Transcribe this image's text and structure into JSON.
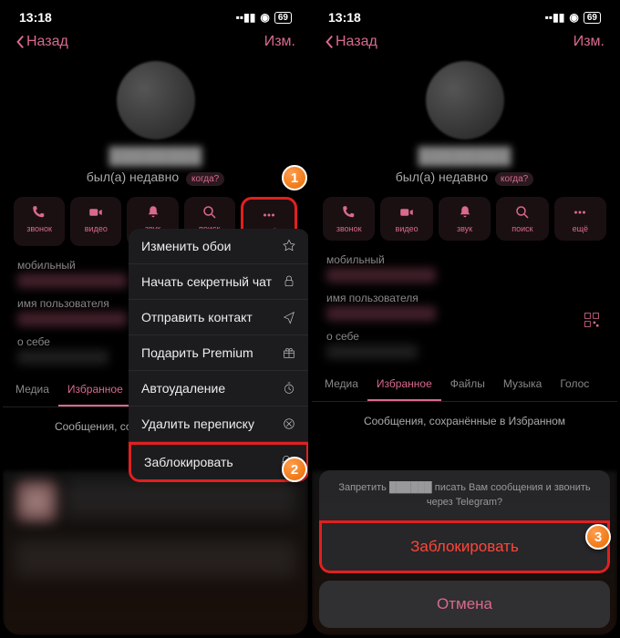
{
  "sb": {
    "time": "13:18",
    "bat": "69"
  },
  "nav": {
    "back": "Назад",
    "edit": "Изм."
  },
  "profile": {
    "name": "████████",
    "status": "был(а) недавно",
    "when": "когда?"
  },
  "act": {
    "call": "звонок",
    "video": "видео",
    "mute": "звук",
    "search": "поиск",
    "more": "ещё"
  },
  "info": {
    "mobile": "мобильный",
    "username": "имя пользователя",
    "about": "о себе"
  },
  "tabs": {
    "media": "Медиа",
    "fav": "Избранное",
    "files": "Файлы",
    "music": "Музыка",
    "voice": "Голос"
  },
  "hint": "Сообщения, сохранённые в Избранном",
  "menu": {
    "wallpaper": "Изменить обои",
    "secret": "Начать секретный чат",
    "send": "Отправить контакт",
    "gift": "Подарить Premium",
    "autodel": "Автоудаление",
    "delchat": "Удалить переписку",
    "block": "Заблокировать"
  },
  "sheet": {
    "q": "Запретить ██████ писать Вам сообщения и звонить через Telegram?",
    "block": "Заблокировать",
    "cancel": "Отмена"
  },
  "mk": {
    "m1": "1",
    "m2": "2",
    "m3": "3"
  }
}
